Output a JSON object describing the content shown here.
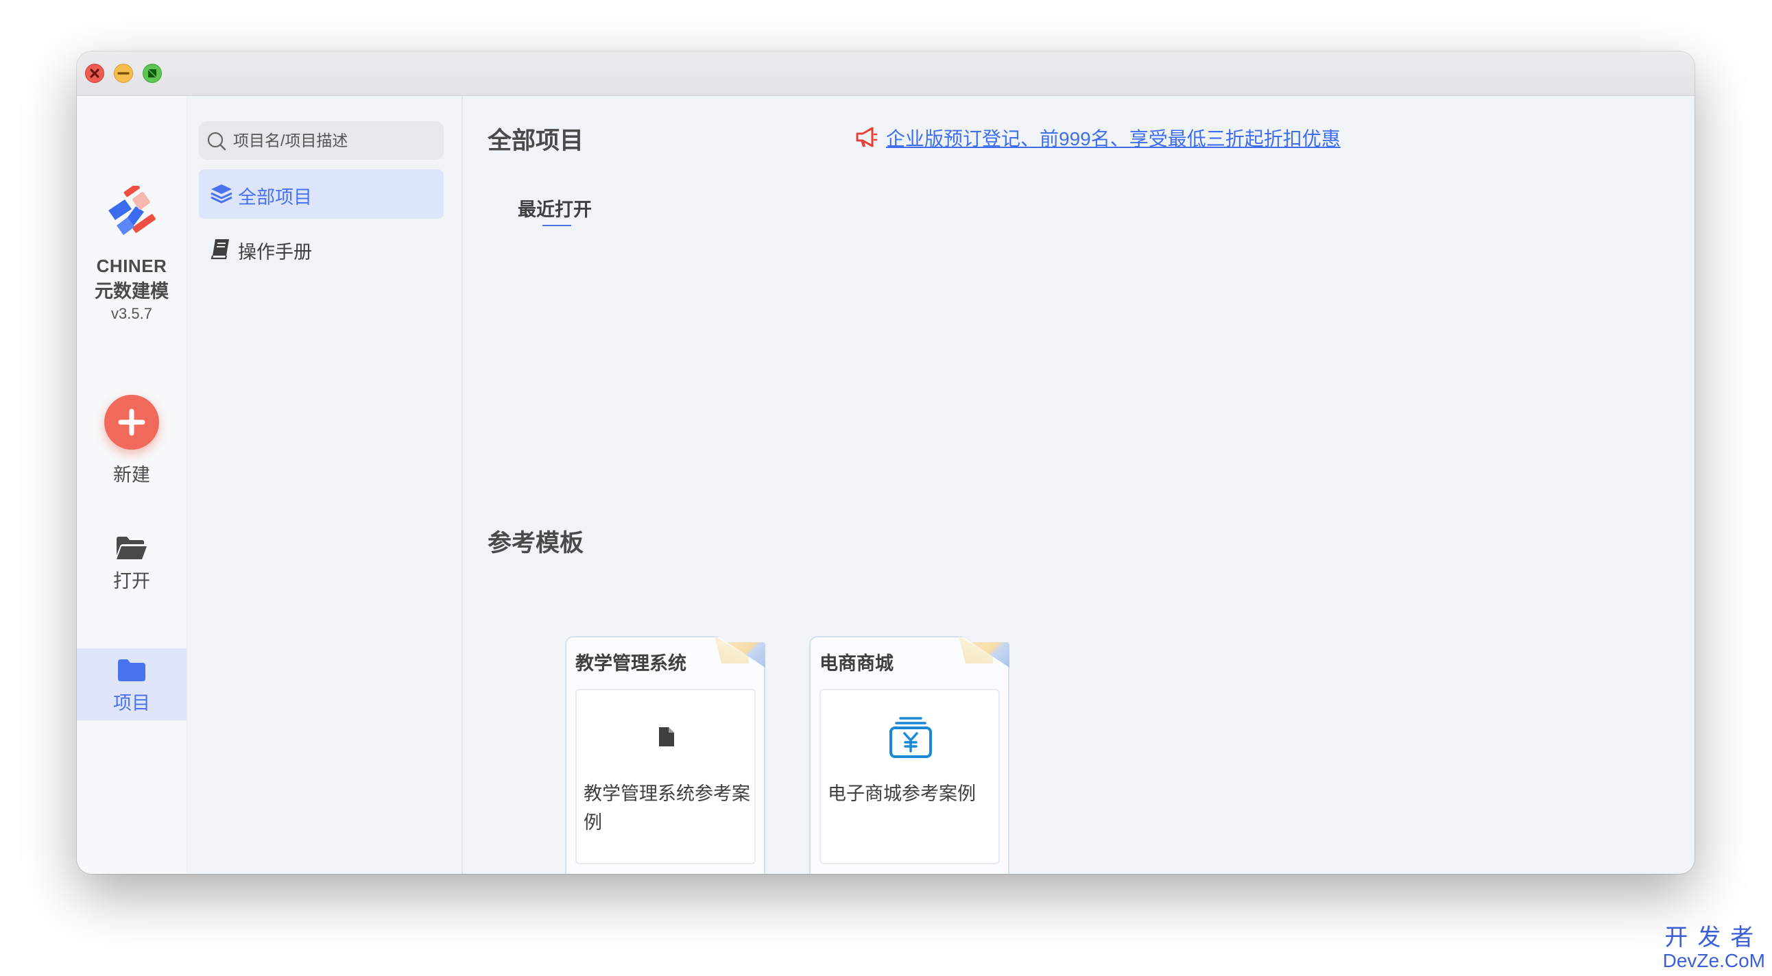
{
  "app": {
    "name": "CHINER",
    "subtitle": "元数建模",
    "version": "v3.5.7"
  },
  "rail": {
    "new_label": "新建",
    "open_label": "打开",
    "projects_label": "项目"
  },
  "sidebar": {
    "search": {
      "placeholder": "项目名/项目描述",
      "value": ""
    },
    "items": [
      {
        "label": "全部项目",
        "icon": "layers-icon",
        "active": true
      },
      {
        "label": "操作手册",
        "icon": "book-icon",
        "active": false
      }
    ]
  },
  "main": {
    "title": "全部项目",
    "promo": {
      "icon": "megaphone-icon",
      "text": "企业版预订登记、前999名、享受最低三折起折扣优惠"
    },
    "recent_tab": "最近打开",
    "templates_title": "参考模板",
    "templates": [
      {
        "title": "教学管理系统",
        "icon": "file-icon",
        "description": "教学管理系统参考案例"
      },
      {
        "title": "电商商城",
        "icon": "yuan-stack-icon",
        "description": "电子商城参考案例"
      }
    ]
  },
  "watermark": {
    "line1": "开发者",
    "line2": "DevZe.CoM"
  },
  "colors": {
    "accent": "#4a72ee",
    "new_button": "#f06a5c",
    "promo_link": "#3d6ef0",
    "promo_icon": "#e6403a",
    "template_icon": "#1a88d8"
  }
}
